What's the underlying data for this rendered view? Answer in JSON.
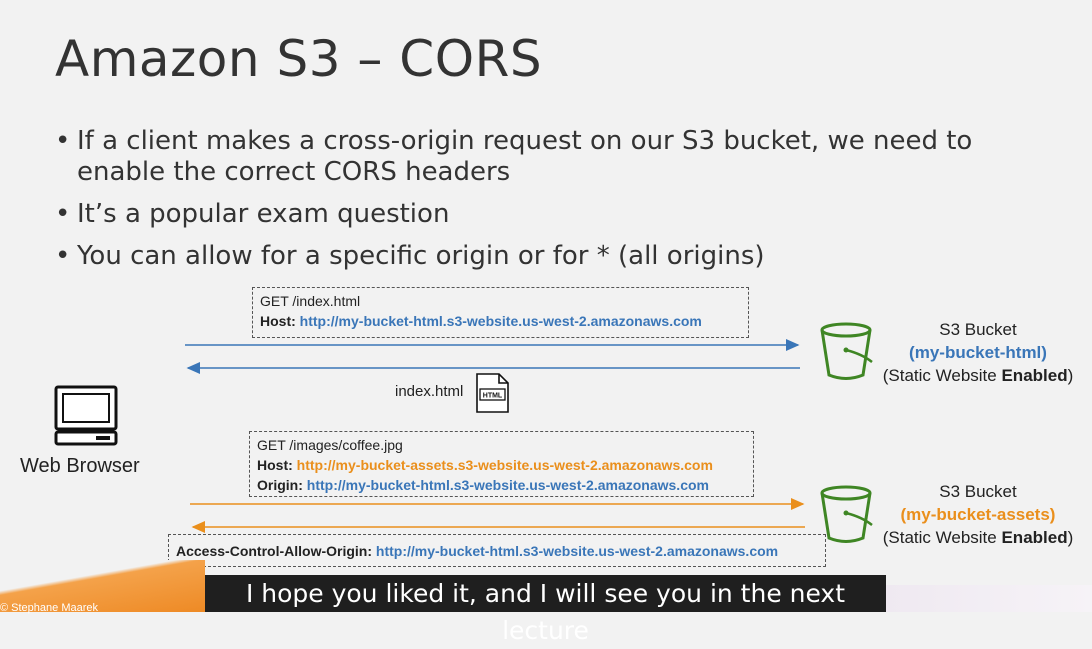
{
  "title": "Amazon S3 – CORS",
  "bullets": [
    "If a client makes a cross-origin request on our S3 bucket, we need to enable the correct CORS headers",
    "It’s a popular exam question",
    "You can allow for a specific origin or for * (all origins)"
  ],
  "request1": {
    "line1": "GET /index.html",
    "host_label": "Host:",
    "host_value": "http://my-bucket-html.s3-website.us-west-2.amazonaws.com"
  },
  "response1": {
    "label": "index.html",
    "icon_text": "HTML"
  },
  "request2": {
    "line1": "GET /images/coffee.jpg",
    "host_label": "Host:",
    "host_value": "http://my-bucket-assets.s3-website.us-west-2.amazonaws.com",
    "origin_label": "Origin:",
    "origin_value": "http://my-bucket-html.s3-website.us-west-2.amazonaws.com"
  },
  "response2": {
    "label": "Access-Control-Allow-Origin:",
    "value": "http://my-bucket-html.s3-website.us-west-2.amazonaws.com"
  },
  "browser": {
    "label": "Web Browser"
  },
  "bucket1": {
    "title": "S3 Bucket",
    "name": "(my-bucket-html)",
    "static_prefix": "(Static Website ",
    "static_enabled": "Enabled",
    "static_suffix": ")"
  },
  "bucket2": {
    "title": "S3 Bucket",
    "name": "(my-bucket-assets)",
    "static_prefix": "(Static Website ",
    "static_enabled": "Enabled",
    "static_suffix": ")"
  },
  "subtitle": "I hope you liked it, and I will see you in the next lecture",
  "corner_text": "© Stephane Maarek",
  "colors": {
    "blue": "#3a76b8",
    "orange": "#ea8f1c",
    "bucket_green": "#3f8624"
  }
}
